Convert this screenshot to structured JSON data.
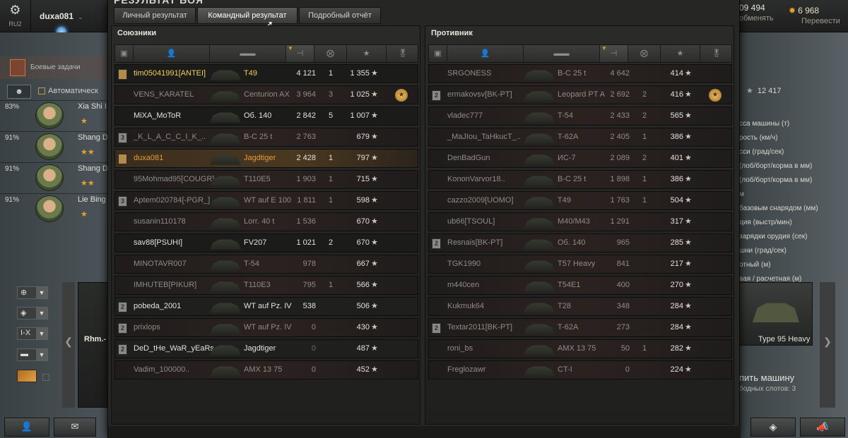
{
  "topbar": {
    "server_code": "RU2",
    "username": "duxa081",
    "credits": "09 494",
    "credits_action": "обменять",
    "gold": "6 968",
    "gold_action": "Перевести"
  },
  "left_sidebar": {
    "quests_label": "Боевые задачи",
    "auto_label": "Автоматическ",
    "crew": [
      {
        "pct": "83%",
        "name": "Xia Shi I",
        "rank": "★"
      },
      {
        "pct": "91%",
        "name": "Shang D",
        "rank": "★★"
      },
      {
        "pct": "91%",
        "name": "Shang D",
        "rank": "★★"
      },
      {
        "pct": "91%",
        "name": "Lie Bing",
        "rank": "★"
      }
    ],
    "filter_nation": "⊕",
    "filter_type": "◈",
    "filter_tier": "I-X",
    "filter_class": "▬",
    "tank_card_name": "Rhm.-"
  },
  "right_sidebar": {
    "experience": "12 417",
    "stat_lines": [
      "сса машины (т)",
      "рость (км/ч)",
      "сси (град/сек)",
      "(лоб/борт/корма в мм)",
      "(лоб/борт/корма в мм)",
      "м",
      "базовым снарядом (мм)",
      "дия (выстр/мин)",
      "зарядки орудия (сек)",
      "шни (град/сек)",
      "отный (м)",
      "вая / расчетная (м)"
    ],
    "selected_tank": "Type 95 Heavy",
    "buy_button": "пить машину",
    "free_slots": "бодных слотов: 3"
  },
  "window": {
    "title": "РЕЗУЛЬТАТ БОЯ",
    "tabs": [
      {
        "label": "Личный результат"
      },
      {
        "label": "Командный результат"
      },
      {
        "label": "Подробный отчёт"
      }
    ],
    "allies_title": "Союзники",
    "enemies_title": "Противник",
    "columns": [
      "platoon",
      "player",
      "tank",
      "damage",
      "kills",
      "xp",
      "medals"
    ],
    "allies": [
      {
        "platoon": "",
        "player": "tim05041991[ANTEI]",
        "tank": "T49",
        "damage": "4 121",
        "kills": "1",
        "xp": "1 355",
        "medal": "",
        "status": "alive-gold"
      },
      {
        "platoon": "",
        "player": "VENS_KARATEL",
        "tank": "Centurion AX",
        "damage": "3 964",
        "kills": "3",
        "xp": "1 025",
        "medal": "★",
        "status": "dead"
      },
      {
        "platoon": "",
        "player": "MiXA_MoToR",
        "tank": "Об. 140",
        "damage": "2 842",
        "kills": "5",
        "xp": "1 007",
        "medal": "",
        "status": "alive"
      },
      {
        "platoon": "3",
        "player": "_K_L_A_C_C_I_K_..",
        "tank": "B-C 25 t",
        "damage": "2 763",
        "kills": "",
        "xp": "679",
        "medal": "",
        "status": "dead"
      },
      {
        "platoon": "",
        "player": "duxa081",
        "tank": "Jagdtiger",
        "damage": "2 428",
        "kills": "1",
        "xp": "797",
        "medal": "",
        "status": "self"
      },
      {
        "platoon": "",
        "player": "95Mohmad95[COUGR]",
        "tank": "T110E5",
        "damage": "1 903",
        "kills": "1",
        "xp": "715",
        "medal": "",
        "status": "dead"
      },
      {
        "platoon": "3",
        "player": "Aptem020784[-PGR_]",
        "tank": "WT auf E 100",
        "damage": "1 811",
        "kills": "1",
        "xp": "598",
        "medal": "",
        "status": "dead"
      },
      {
        "platoon": "",
        "player": "susanin110178",
        "tank": "Lorr. 40 t",
        "damage": "1 536",
        "kills": "",
        "xp": "670",
        "medal": "",
        "status": "dead"
      },
      {
        "platoon": "",
        "player": "sav88[PSUHI]",
        "tank": "FV207",
        "damage": "1 021",
        "kills": "2",
        "xp": "670",
        "medal": "",
        "status": "alive"
      },
      {
        "platoon": "",
        "player": "MINOTAVR007",
        "tank": "T-54",
        "damage": "978",
        "kills": "",
        "xp": "667",
        "medal": "",
        "status": "dead"
      },
      {
        "platoon": "",
        "player": "IMHUTEB[PIKUR]",
        "tank": "T110E3",
        "damage": "795",
        "kills": "1",
        "xp": "566",
        "medal": "",
        "status": "dead"
      },
      {
        "platoon": "2",
        "player": "pobeda_2001",
        "tank": "WT auf Pz. IV",
        "damage": "538",
        "kills": "",
        "xp": "506",
        "medal": "",
        "status": "alive"
      },
      {
        "platoon": "2",
        "player": "prixlops",
        "tank": "WT auf Pz. IV",
        "damage": "0",
        "kills": "",
        "xp": "430",
        "medal": "",
        "status": "dead"
      },
      {
        "platoon": "2",
        "player": "DeD_tHe_WaR_yEaRs",
        "tank": "Jagdtiger",
        "damage": "0",
        "kills": "",
        "xp": "487",
        "medal": "",
        "status": "alive"
      },
      {
        "platoon": "",
        "player": "Vadim_100000..",
        "tank": "AMX 13 75",
        "damage": "0",
        "kills": "",
        "xp": "452",
        "medal": "",
        "status": "dead"
      }
    ],
    "enemies": [
      {
        "platoon": "",
        "player": "SRGONESS",
        "tank": "B-C 25 t",
        "damage": "4 642",
        "kills": "",
        "xp": "414",
        "medal": "",
        "status": "dead"
      },
      {
        "platoon": "2",
        "player": "ermakovsv[BK-PT]",
        "tank": "Leopard PT A",
        "damage": "2 692",
        "kills": "2",
        "xp": "416",
        "medal": "★",
        "status": "dead"
      },
      {
        "platoon": "",
        "player": "vladec777",
        "tank": "T-54",
        "damage": "2 433",
        "kills": "2",
        "xp": "565",
        "medal": "",
        "status": "dead"
      },
      {
        "platoon": "",
        "player": "_MaJIou_TaHkucT_..",
        "tank": "T-62A",
        "damage": "2 405",
        "kills": "1",
        "xp": "386",
        "medal": "",
        "status": "dead"
      },
      {
        "platoon": "",
        "player": "DenBadGun",
        "tank": "ИС-7",
        "damage": "2 089",
        "kills": "2",
        "xp": "401",
        "medal": "",
        "status": "dead"
      },
      {
        "platoon": "",
        "player": "KononVarvor18..",
        "tank": "B-C 25 t",
        "damage": "1 898",
        "kills": "1",
        "xp": "386",
        "medal": "",
        "status": "dead"
      },
      {
        "platoon": "",
        "player": "cazzo2009[UOMO]",
        "tank": "T49",
        "damage": "1 763",
        "kills": "1",
        "xp": "504",
        "medal": "",
        "status": "dead"
      },
      {
        "platoon": "",
        "player": "ub66[TSOUL]",
        "tank": "M40/M43",
        "damage": "1 291",
        "kills": "",
        "xp": "317",
        "medal": "",
        "status": "dead"
      },
      {
        "platoon": "2",
        "player": "Resnais[BK-PT]",
        "tank": "Об. 140",
        "damage": "965",
        "kills": "",
        "xp": "285",
        "medal": "",
        "status": "dead"
      },
      {
        "platoon": "",
        "player": "TGK1990",
        "tank": "T57 Heavy",
        "damage": "841",
        "kills": "",
        "xp": "217",
        "medal": "",
        "status": "dead"
      },
      {
        "platoon": "",
        "player": "m440cen",
        "tank": "T54E1",
        "damage": "400",
        "kills": "",
        "xp": "270",
        "medal": "",
        "status": "dead"
      },
      {
        "platoon": "",
        "player": "Kukmuk64",
        "tank": "T28",
        "damage": "348",
        "kills": "",
        "xp": "284",
        "medal": "",
        "status": "dead"
      },
      {
        "platoon": "2",
        "player": "Textar2011[BK-PT]",
        "tank": "T-62A",
        "damage": "273",
        "kills": "",
        "xp": "284",
        "medal": "",
        "status": "dead"
      },
      {
        "platoon": "",
        "player": "roni_bs",
        "tank": "AMX 13 75",
        "damage": "50",
        "kills": "1",
        "xp": "282",
        "medal": "",
        "status": "dead"
      },
      {
        "platoon": "",
        "player": "Freglozawr",
        "tank": "CT-I",
        "damage": "0",
        "kills": "",
        "xp": "224",
        "medal": "",
        "status": "dead"
      }
    ]
  }
}
